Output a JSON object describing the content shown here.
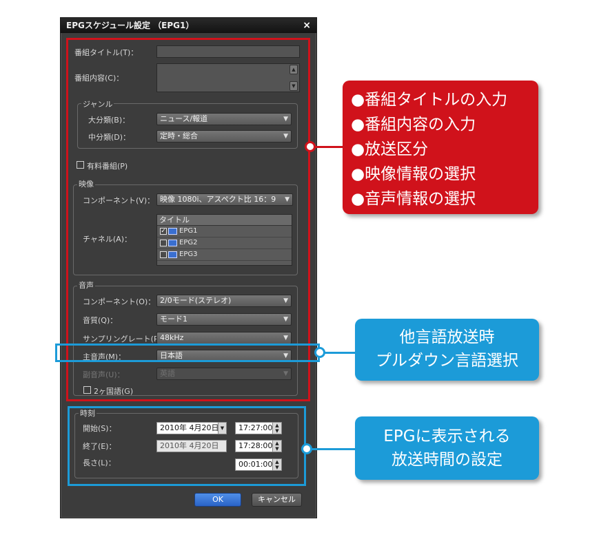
{
  "dialog": {
    "title": "EPGスケジュール設定 （EPG1）",
    "close_label": "×",
    "program_title_label": "番組タイトル(T)：",
    "program_title_value": "",
    "program_content_label": "番組内容(C)：",
    "program_content_value": "",
    "genre": {
      "group_label": "ジャンル",
      "major_label": "大分類(B)：",
      "major_value": "ニュース/報道",
      "minor_label": "中分類(D)：",
      "minor_value": "定時・総合"
    },
    "paid_label": "有料番組(P)",
    "video": {
      "group_label": "映像",
      "component_label": "コンポーネント(V)：",
      "component_value": "映像 1080i、アスペクト比 16：9",
      "channel_label": "チャネル(A)：",
      "channel_header": "タイトル",
      "channels": [
        {
          "name": "EPG1",
          "checked": true
        },
        {
          "name": "EPG2",
          "checked": false
        },
        {
          "name": "EPG3",
          "checked": false
        }
      ]
    },
    "audio": {
      "group_label": "音声",
      "component_label": "コンポーネント(O)：",
      "component_value": "2/0モード(ステレオ)",
      "quality_label": "音質(Q)：",
      "quality_value": "モード1",
      "sampling_label": "サンプリングレート(R)：",
      "sampling_value": "48kHz",
      "main_audio_label": "主音声(M)：",
      "main_audio_value": "日本語",
      "sub_audio_label": "副音声(U)：",
      "sub_audio_value": "英語",
      "bilingual_label": "2ヶ国語(G)"
    },
    "time": {
      "group_label": "時刻",
      "start_label": "開始(S)：",
      "start_date": "2010年 4月20日",
      "start_time": "17:27:00",
      "end_label": "終了(E)：",
      "end_date": "2010年 4月20日",
      "end_time": "17:28:00",
      "length_label": "長さ(L)：",
      "length_time": "00:01:00"
    },
    "ok_label": "OK",
    "cancel_label": "キャンセル"
  },
  "callouts": {
    "red_items": [
      "●番組タイトルの入力",
      "●番組内容の入力",
      "●放送区分",
      "●映像情報の選択",
      "●音声情報の選択"
    ],
    "blue_audio": [
      "他言語放送時",
      "プルダウン言語選択"
    ],
    "blue_time": [
      "EPGに表示される",
      "放送時間の設定"
    ]
  },
  "colors": {
    "red": "#d0121b",
    "blue": "#1c9bd8",
    "dialog_bg": "#3c3c3c"
  }
}
